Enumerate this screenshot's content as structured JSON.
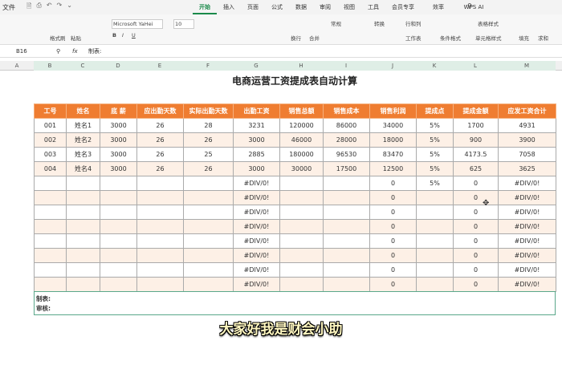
{
  "menubar": {
    "file": "文件",
    "tabs": [
      "开始",
      "插入",
      "页面",
      "公式",
      "数据",
      "审阅",
      "视图",
      "工具",
      "会员专享",
      "效率",
      "WPS AI"
    ],
    "active": "开始"
  },
  "ribbon": {
    "format_painter": "格式刷",
    "paste": "粘贴",
    "font": "Microsoft YaHei",
    "size": "10",
    "wrap": "换行",
    "merge": "合并",
    "number_format": "常规",
    "convert": "转换",
    "rows_cols": "行和列",
    "worksheet": "工作表",
    "cond_format": "条件格式",
    "table_style": "表格样式",
    "cell_style": "单元格样式",
    "fill": "填充",
    "sum": "求和"
  },
  "formula_bar": {
    "cell_ref": "B16",
    "content": "制表:"
  },
  "columns": [
    "A",
    "B",
    "C",
    "D",
    "E",
    "F",
    "G",
    "H",
    "I",
    "J",
    "K",
    "L",
    "M"
  ],
  "sheet": {
    "title": "电商运营工资提成表自动计算",
    "headers": [
      "工号",
      "姓名",
      "底 薪",
      "应出勤天数",
      "实际出勤天数",
      "出勤工资",
      "销售总额",
      "销售成本",
      "销售利润",
      "提成点",
      "提成金额",
      "应发工资合计"
    ],
    "rows": [
      [
        "001",
        "姓名1",
        "3000",
        "26",
        "28",
        "3231",
        "120000",
        "86000",
        "34000",
        "5%",
        "1700",
        "4931"
      ],
      [
        "002",
        "姓名2",
        "3000",
        "26",
        "26",
        "3000",
        "46000",
        "28000",
        "18000",
        "5%",
        "900",
        "3900"
      ],
      [
        "003",
        "姓名3",
        "3000",
        "26",
        "25",
        "2885",
        "180000",
        "96530",
        "83470",
        "5%",
        "4173.5",
        "7058"
      ],
      [
        "004",
        "姓名4",
        "3000",
        "26",
        "26",
        "3000",
        "30000",
        "17500",
        "12500",
        "5%",
        "625",
        "3625"
      ],
      [
        "",
        "",
        "",
        "",
        "",
        "#DIV/0!",
        "",
        "",
        "0",
        "5%",
        "0",
        "#DIV/0!"
      ],
      [
        "",
        "",
        "",
        "",
        "",
        "#DIV/0!",
        "",
        "",
        "0",
        "",
        "0",
        "#DIV/0!"
      ],
      [
        "",
        "",
        "",
        "",
        "",
        "#DIV/0!",
        "",
        "",
        "0",
        "",
        "0",
        "#DIV/0!"
      ],
      [
        "",
        "",
        "",
        "",
        "",
        "#DIV/0!",
        "",
        "",
        "0",
        "",
        "0",
        "#DIV/0!"
      ],
      [
        "",
        "",
        "",
        "",
        "",
        "#DIV/0!",
        "",
        "",
        "0",
        "",
        "0",
        "#DIV/0!"
      ],
      [
        "",
        "",
        "",
        "",
        "",
        "#DIV/0!",
        "",
        "",
        "0",
        "",
        "0",
        "#DIV/0!"
      ],
      [
        "",
        "",
        "",
        "",
        "",
        "#DIV/0!",
        "",
        "",
        "0",
        "",
        "0",
        "#DIV/0!"
      ],
      [
        "",
        "",
        "",
        "",
        "",
        "#DIV/0!",
        "",
        "",
        "0",
        "",
        "0",
        "#DIV/0!"
      ]
    ],
    "footer": {
      "made_by": "制表:",
      "reviewed_by": "审核:"
    }
  },
  "subtitle": "大家好我是财会小助",
  "colors": {
    "header": "#ef7d31",
    "alt_row": "#fdf0e6",
    "accent": "#1a8a4a"
  }
}
